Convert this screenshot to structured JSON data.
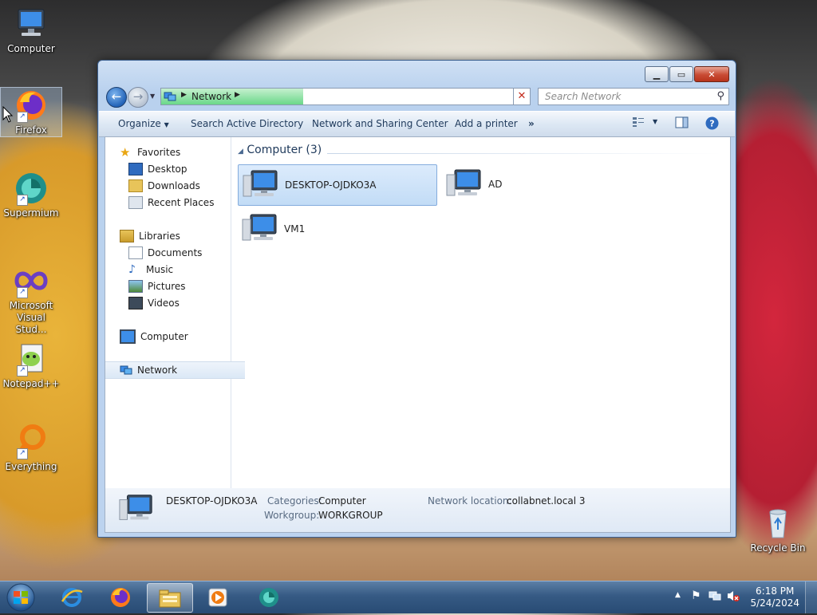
{
  "desktop": {
    "icons": [
      {
        "label": "Computer",
        "icon": "computer-icon"
      },
      {
        "label": "Firefox",
        "icon": "firefox-icon"
      },
      {
        "label": "Supermium",
        "icon": "supermium-icon"
      },
      {
        "label": "Microsoft Visual Stud...",
        "label_line1": "Microsoft",
        "label_line2": "Visual Stud...",
        "icon": "visual-studio-icon"
      },
      {
        "label": "Notepad++",
        "icon": "notepadpp-icon"
      },
      {
        "label": "Everything",
        "icon": "everything-icon"
      },
      {
        "label": "Recycle Bin",
        "icon": "recycle-bin-icon"
      }
    ]
  },
  "window": {
    "address": {
      "location": "Network"
    },
    "search": {
      "placeholder": "Search Network"
    },
    "toolbar": {
      "organize": "Organize",
      "search_ad": "Search Active Directory",
      "network_center": "Network and Sharing Center",
      "add_printer": "Add a printer",
      "more": "»"
    },
    "nav_pane": {
      "favorites": "Favorites",
      "desktop": "Desktop",
      "downloads": "Downloads",
      "recent_places": "Recent Places",
      "libraries": "Libraries",
      "documents": "Documents",
      "music": "Music",
      "pictures": "Pictures",
      "videos": "Videos",
      "computer": "Computer",
      "network": "Network"
    },
    "group": {
      "title": "Computer (3)"
    },
    "items": [
      {
        "name": "DESKTOP-OJDKO3A",
        "selected": true
      },
      {
        "name": "AD",
        "selected": false
      },
      {
        "name": "VM1",
        "selected": false
      }
    ],
    "details": {
      "name": "DESKTOP-OJDKO3A",
      "categories_label": "Categories:",
      "categories_value": "Computer",
      "workgroup_label": "Workgroup:",
      "workgroup_value": "WORKGROUP",
      "network_location_label": "Network location:",
      "network_location_value": "collabnet.local 3"
    }
  },
  "taskbar": {
    "clock_time": "6:18 PM",
    "clock_date": "5/24/2024",
    "apps": [
      "internet-explorer-icon",
      "firefox-icon",
      "windows-explorer-icon",
      "media-player-icon",
      "supermium-icon"
    ]
  },
  "colors": {
    "accent": "#3a6ea5",
    "selection": "#c2dcf6",
    "address_progress": "#6ad889",
    "close_button": "#c84b33"
  }
}
